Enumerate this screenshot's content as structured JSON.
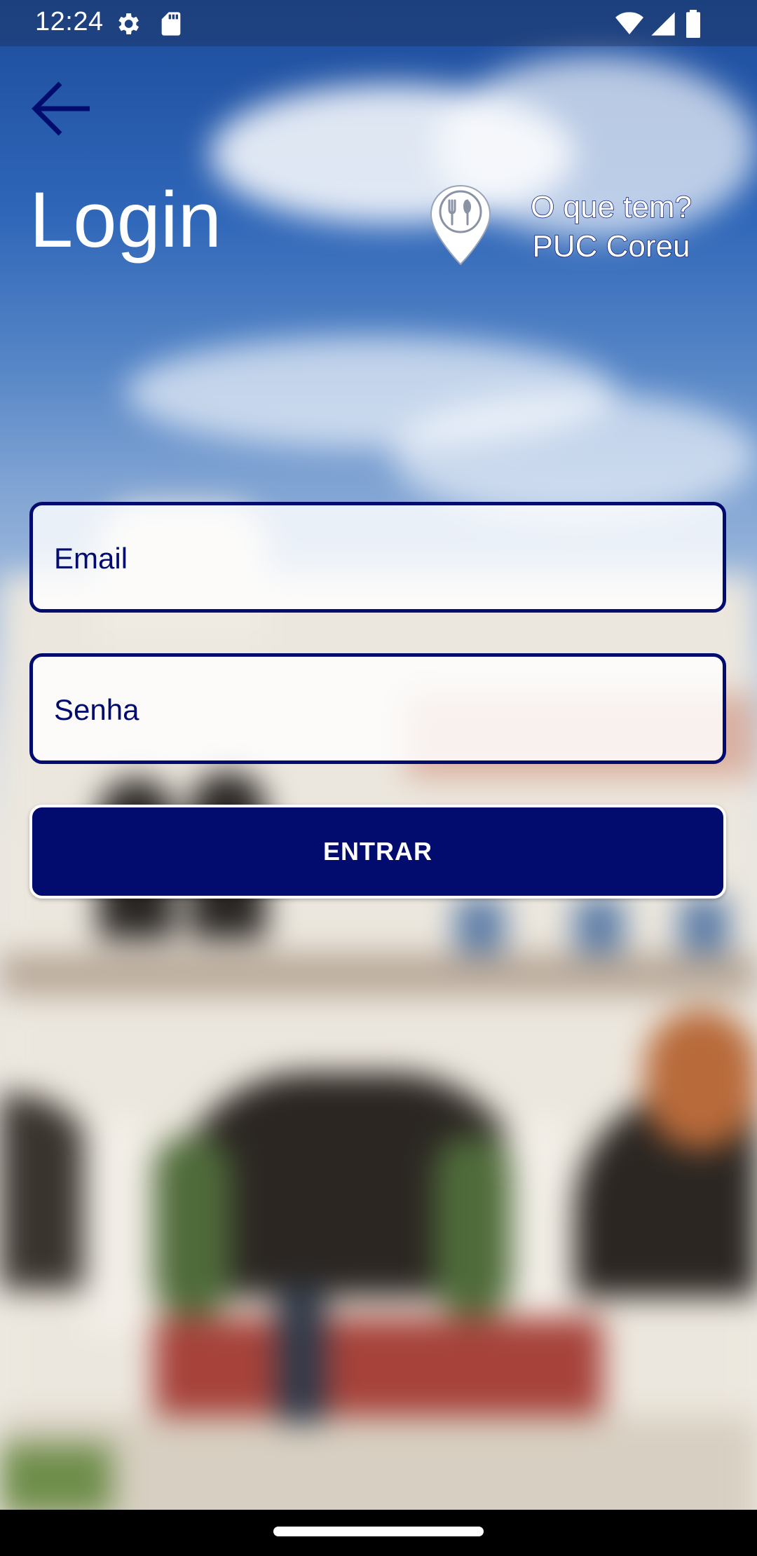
{
  "status_bar": {
    "time": "12:24",
    "icons": [
      "settings-icon",
      "sd-card-icon",
      "wifi-icon",
      "signal-icon",
      "battery-icon"
    ]
  },
  "header": {
    "back_icon": "arrow-back-icon",
    "title": "Login"
  },
  "brand": {
    "icon": "location-pin-utensils-icon",
    "line1": "O que tem?",
    "line2": "PUC Coreu"
  },
  "form": {
    "email_placeholder": "Email",
    "password_placeholder": "Senha",
    "submit_label": "ENTRAR"
  },
  "colors": {
    "primary": "#020b6e",
    "text_light": "#ffffff"
  }
}
